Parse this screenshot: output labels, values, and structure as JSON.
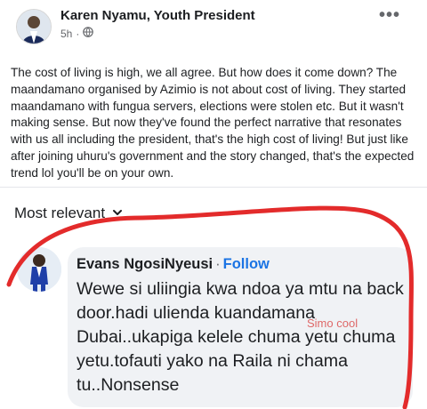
{
  "post": {
    "author": "Karen Nyamu, Youth President",
    "timestamp": "5h",
    "meta_sep": "·",
    "audience_icon": "globe-icon",
    "more_icon": "more-dots-icon",
    "more_glyph": "•••",
    "body": "The cost of living is high, we all agree. But how does it come down? The maandamano organised by Azimio is not about cost of living. They started maandamano with fungua servers, elections were stolen etc. But it wasn't making sense. But now they've found the perfect narrative that resonates with us all including the president, that's the high cost of living! But just like after joining uhuru's government and the story changed, that's the expected trend lol you'll be on your own."
  },
  "comments_section": {
    "sort_label": "Most relevant",
    "sort_icon": "chevron-down-icon"
  },
  "comment": {
    "author": "Evans NgosiNyeusi",
    "separator": "·",
    "follow_label": "Follow",
    "text": "Wewe si uliingia kwa ndoa ya mtu na back door.hadi ulienda kuandamana Dubai..ukapiga kelele chuma yetu chuma yetu.tofauti yako na Raila ni chama tu..Nonsense",
    "watermark": "Simo cool"
  },
  "colors": {
    "link_blue": "#1b74e4",
    "marker_red": "#e32b2b",
    "bubble_bg": "#f0f2f5",
    "meta_gray": "#65676b"
  }
}
